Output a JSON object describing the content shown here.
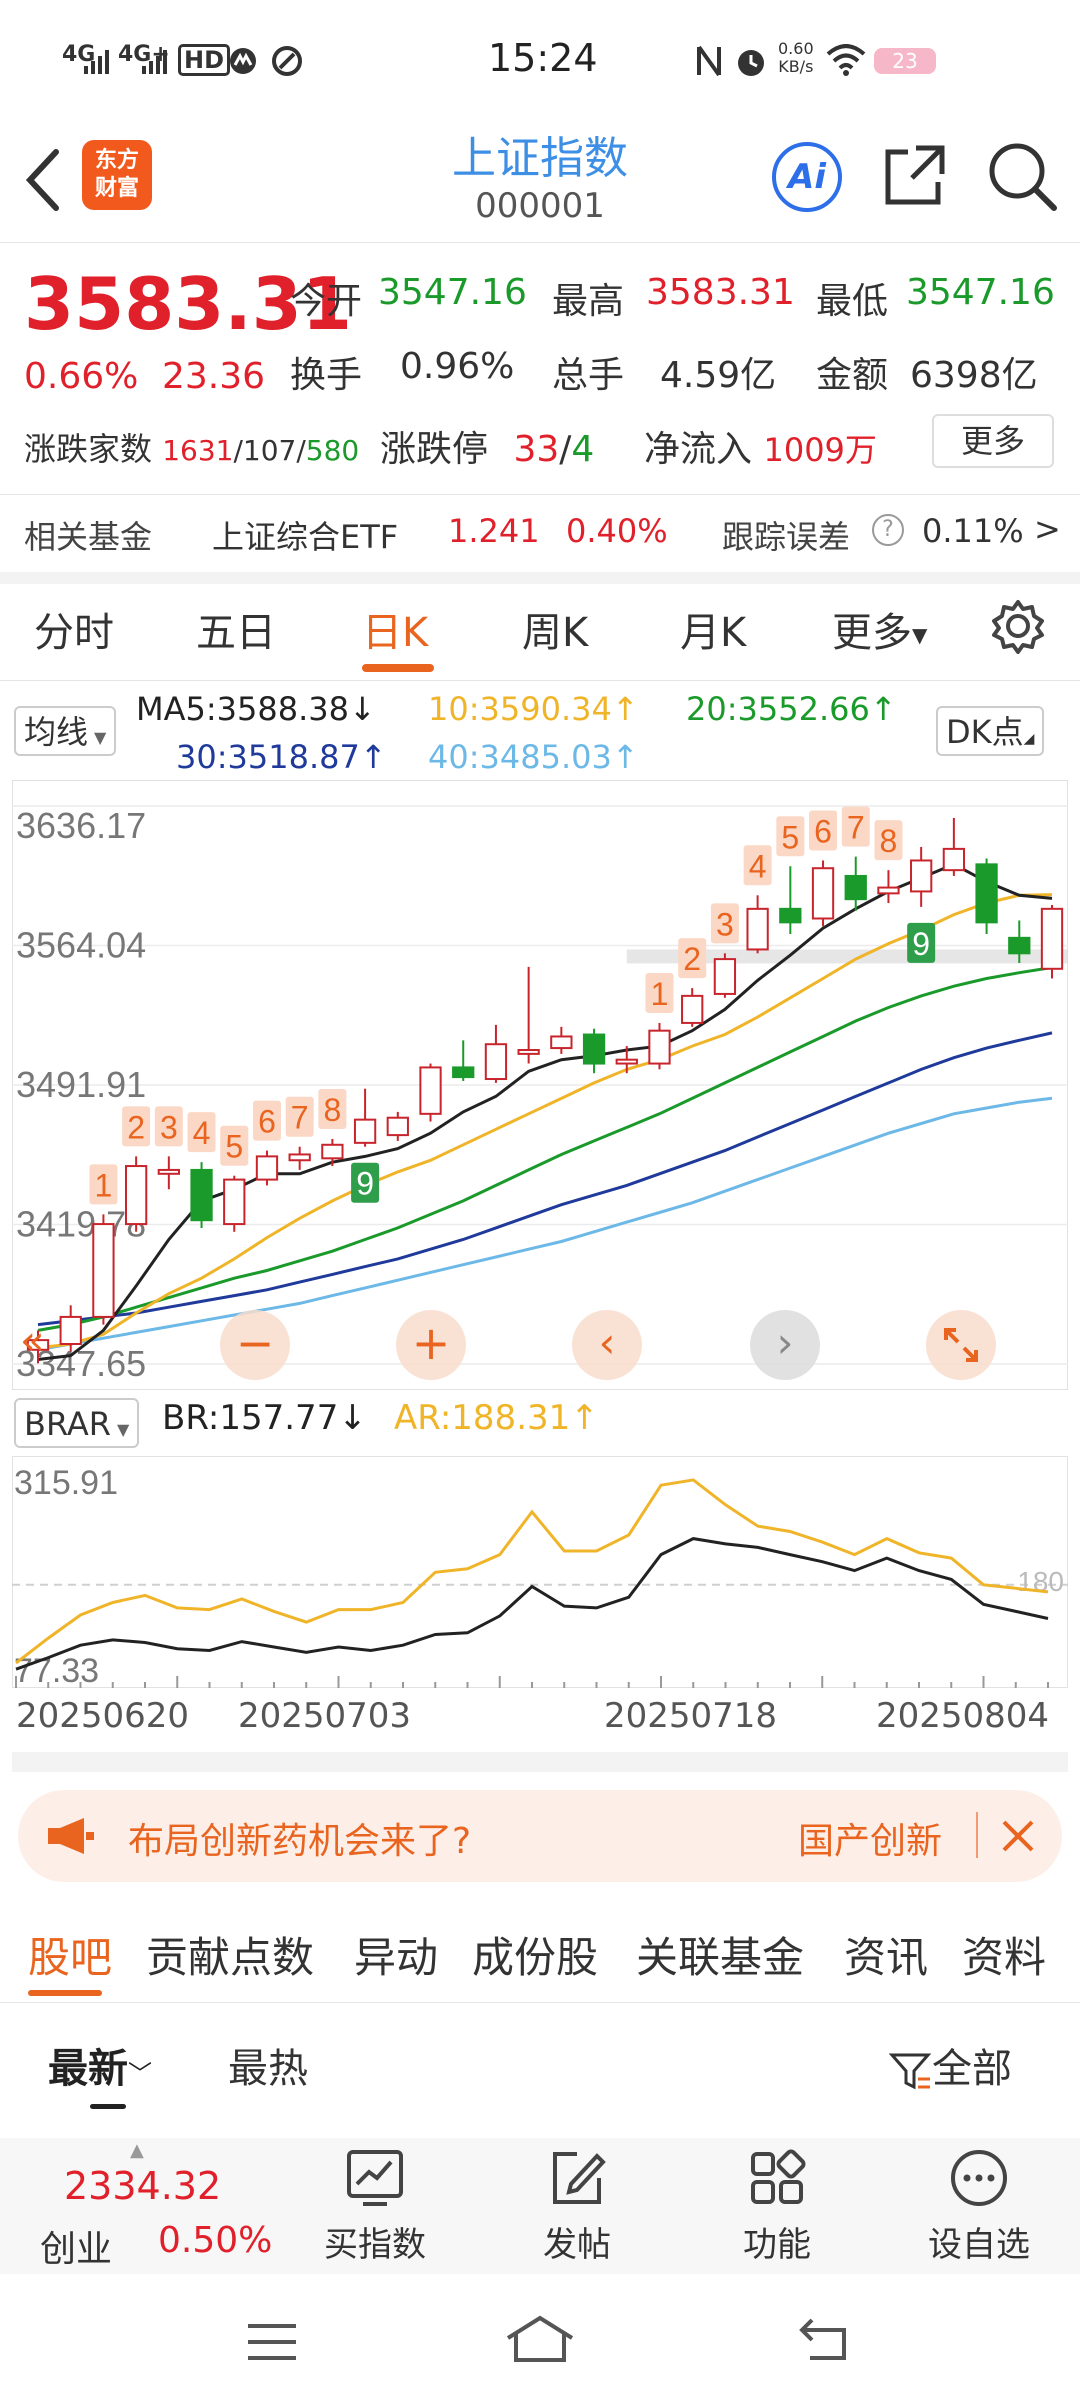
{
  "status": {
    "signal1": "4G",
    "signal2": "4G+",
    "hd": "HD",
    "time": "15:24",
    "net_speed_value": "0.60",
    "net_speed_unit": "KB/s",
    "battery": "23"
  },
  "header": {
    "logo_line1": "东方",
    "logo_line2": "财富",
    "title": "上证指数",
    "code": "000001",
    "ai_label": "Ai"
  },
  "quote": {
    "price": "3583.31",
    "change_pct": "0.66%",
    "change_amt": "23.36",
    "open_label": "今开",
    "open": "3547.16",
    "high_label": "最高",
    "high": "3583.31",
    "low_label": "最低",
    "low": "3547.16",
    "turnover_label": "换手",
    "turnover": "0.96%",
    "volume_label": "总手",
    "volume": "4.59亿",
    "amount_label": "金额",
    "amount": "6398亿",
    "updown_label": "涨跌家数",
    "up": "1631",
    "flat": "107",
    "down": "580",
    "limit_label": "涨跌停",
    "limit_up": "33",
    "limit_down": "4",
    "netflow_label": "净流入",
    "netflow": "1009万",
    "more_label": "更多"
  },
  "fund": {
    "label": "相关基金",
    "name": "上证综合ETF",
    "price": "1.241",
    "pct": "0.40%",
    "track_label": "跟踪误差",
    "track_value": "0.11%",
    "arrow": ">"
  },
  "ktabs": [
    {
      "label": "分时"
    },
    {
      "label": "五日"
    },
    {
      "label": "日K"
    },
    {
      "label": "周K"
    },
    {
      "label": "月K"
    },
    {
      "label": "更多"
    }
  ],
  "ma": {
    "selector": "均线",
    "ma5": "MA5:3588.38",
    "ma10": "10:3590.34",
    "ma20": "20:3552.66",
    "ma30": "30:3518.87",
    "ma40": "40:3485.03",
    "dk_label": "DK点",
    "color_ma5": "#222222",
    "color_ma10": "#f0b429",
    "color_ma20": "#1a9a2a",
    "color_ma30": "#1f3a9a",
    "color_ma40": "#6cb8e6"
  },
  "chart_data": {
    "type": "candlestick",
    "y_ticks": [
      "3636.17",
      "3564.04",
      "3491.91",
      "3419.78",
      "3347.65"
    ],
    "ylim": [
      3347.65,
      3636.17
    ],
    "x_labels": [
      "20250620",
      "20250703",
      "20250718",
      "20250804"
    ],
    "candles": [
      {
        "o": 3355,
        "c": 3360,
        "h": 3365,
        "l": 3348
      },
      {
        "o": 3358,
        "c": 3372,
        "h": 3378,
        "l": 3354
      },
      {
        "o": 3372,
        "c": 3420,
        "h": 3425,
        "l": 3368
      },
      {
        "o": 3420,
        "c": 3450,
        "h": 3455,
        "l": 3416
      },
      {
        "o": 3446,
        "c": 3448,
        "h": 3455,
        "l": 3438
      },
      {
        "o": 3448,
        "c": 3422,
        "h": 3452,
        "l": 3418
      },
      {
        "o": 3420,
        "c": 3443,
        "h": 3445,
        "l": 3416
      },
      {
        "o": 3443,
        "c": 3455,
        "h": 3458,
        "l": 3440
      },
      {
        "o": 3453,
        "c": 3456,
        "h": 3460,
        "l": 3448
      },
      {
        "o": 3454,
        "c": 3461,
        "h": 3464,
        "l": 3450
      },
      {
        "o": 3462,
        "c": 3474,
        "h": 3490,
        "l": 3460
      },
      {
        "o": 3466,
        "c": 3475,
        "h": 3478,
        "l": 3463
      },
      {
        "o": 3477,
        "c": 3501,
        "h": 3503,
        "l": 3473
      },
      {
        "o": 3501,
        "c": 3496,
        "h": 3515,
        "l": 3494
      },
      {
        "o": 3495,
        "c": 3513,
        "h": 3523,
        "l": 3493
      },
      {
        "o": 3508,
        "c": 3510,
        "h": 3553,
        "l": 3503
      },
      {
        "o": 3511,
        "c": 3517,
        "h": 3522,
        "l": 3508
      },
      {
        "o": 3518,
        "c": 3503,
        "h": 3521,
        "l": 3498
      },
      {
        "o": 3503,
        "c": 3505,
        "h": 3512,
        "l": 3498
      },
      {
        "o": 3503,
        "c": 3520,
        "h": 3524,
        "l": 3500
      },
      {
        "o": 3524,
        "c": 3538,
        "h": 3542,
        "l": 3522
      },
      {
        "o": 3539,
        "c": 3557,
        "h": 3560,
        "l": 3537
      },
      {
        "o": 3562,
        "c": 3583,
        "h": 3590,
        "l": 3560
      },
      {
        "o": 3583,
        "c": 3576,
        "h": 3605,
        "l": 3570
      },
      {
        "o": 3578,
        "c": 3604,
        "h": 3608,
        "l": 3574
      },
      {
        "o": 3600,
        "c": 3588,
        "h": 3610,
        "l": 3582
      },
      {
        "o": 3591,
        "c": 3594,
        "h": 3603,
        "l": 3586
      },
      {
        "o": 3592,
        "c": 3608,
        "h": 3615,
        "l": 3584
      },
      {
        "o": 3603,
        "c": 3614,
        "h": 3630,
        "l": 3600
      },
      {
        "o": 3606,
        "c": 3576,
        "h": 3609,
        "l": 3570
      },
      {
        "o": 3568,
        "c": 3560,
        "h": 3577,
        "l": 3555
      },
      {
        "o": 3552,
        "c": 3583,
        "h": 3585,
        "l": 3547
      }
    ],
    "ma5": [
      3350,
      3352,
      3365,
      3388,
      3412,
      3432,
      3438,
      3446,
      3446,
      3452,
      3455,
      3459,
      3467,
      3478,
      3486,
      3499,
      3505,
      3507,
      3510,
      3512,
      3520,
      3531,
      3546,
      3559,
      3573,
      3583,
      3592,
      3599,
      3606,
      3597,
      3590,
      3588.38
    ],
    "ma10": [
      3356,
      3358,
      3363,
      3374,
      3384,
      3392,
      3402,
      3413,
      3423,
      3432,
      3440,
      3447,
      3453,
      3461,
      3469,
      3477,
      3485,
      3493,
      3500,
      3505,
      3512,
      3518,
      3527,
      3537,
      3547,
      3557,
      3565,
      3572,
      3580,
      3586,
      3590,
      3590.34
    ],
    "ma20": [
      3365,
      3368,
      3372,
      3377,
      3382,
      3387,
      3392,
      3396,
      3401,
      3406,
      3412,
      3418,
      3425,
      3432,
      3440,
      3448,
      3456,
      3463,
      3470,
      3477,
      3485,
      3493,
      3501,
      3509,
      3517,
      3525,
      3532,
      3538,
      3543,
      3547,
      3550,
      3552.66
    ],
    "ma30": [
      3368,
      3370,
      3372,
      3374,
      3377,
      3380,
      3383,
      3386,
      3390,
      3394,
      3398,
      3402,
      3407,
      3412,
      3418,
      3424,
      3430,
      3435,
      3440,
      3446,
      3452,
      3458,
      3465,
      3472,
      3479,
      3486,
      3493,
      3500,
      3506,
      3511,
      3515,
      3518.87
    ],
    "ma40": [
      3355,
      3358,
      3361,
      3364,
      3367,
      3370,
      3373,
      3376,
      3379,
      3383,
      3387,
      3391,
      3395,
      3399,
      3403,
      3407,
      3411,
      3416,
      3421,
      3426,
      3431,
      3437,
      3443,
      3449,
      3455,
      3461,
      3467,
      3472,
      3477,
      3480,
      3483,
      3485.03
    ],
    "td_labels": [
      {
        "i": 2,
        "t": "1",
        "kind": "up"
      },
      {
        "i": 3,
        "t": "2",
        "kind": "up"
      },
      {
        "i": 4,
        "t": "3",
        "kind": "up"
      },
      {
        "i": 5,
        "t": "4",
        "kind": "up"
      },
      {
        "i": 6,
        "t": "5",
        "kind": "up"
      },
      {
        "i": 7,
        "t": "6",
        "kind": "up"
      },
      {
        "i": 8,
        "t": "7",
        "kind": "up"
      },
      {
        "i": 9,
        "t": "8",
        "kind": "up"
      },
      {
        "i": 10,
        "t": "9",
        "kind": "down"
      },
      {
        "i": 19,
        "t": "1",
        "kind": "up"
      },
      {
        "i": 20,
        "t": "2",
        "kind": "up"
      },
      {
        "i": 21,
        "t": "3",
        "kind": "up"
      },
      {
        "i": 22,
        "t": "4",
        "kind": "up"
      },
      {
        "i": 23,
        "t": "5",
        "kind": "up"
      },
      {
        "i": 24,
        "t": "6",
        "kind": "up"
      },
      {
        "i": 25,
        "t": "7",
        "kind": "up"
      },
      {
        "i": 26,
        "t": "8",
        "kind": "up"
      },
      {
        "i": 27,
        "t": "9",
        "kind": "down"
      }
    ]
  },
  "brar": {
    "selector": "BRAR",
    "br": "BR:157.77",
    "ar": "AR:188.31",
    "y_top": "315.91",
    "y_bottom": "77.33",
    "ref_label": "180",
    "ylim": [
      77.33,
      315.91
    ],
    "br_values": [
      85,
      98,
      112,
      118,
      115,
      108,
      106,
      116,
      110,
      104,
      110,
      106,
      112,
      124,
      126,
      145,
      178,
      156,
      154,
      166,
      214,
      232,
      226,
      222,
      214,
      206,
      196,
      210,
      196,
      186,
      158,
      150,
      142
    ],
    "ar_values": [
      92,
      120,
      146,
      160,
      168,
      154,
      152,
      164,
      150,
      138,
      152,
      152,
      160,
      194,
      198,
      214,
      262,
      218,
      218,
      236,
      292,
      298,
      270,
      246,
      240,
      228,
      214,
      232,
      216,
      210,
      180,
      176,
      172
    ]
  },
  "ad": {
    "text": "布局创新药机会来了?",
    "tag": "国产创新"
  },
  "btabs": [
    {
      "label": "股吧"
    },
    {
      "label": "贡献点数"
    },
    {
      "label": "异动"
    },
    {
      "label": "成份股"
    },
    {
      "label": "关联基金"
    },
    {
      "label": "资讯"
    },
    {
      "label": "资料"
    }
  ],
  "sort": {
    "latest": "最新",
    "hot": "最热",
    "filter": "全部"
  },
  "bottom": {
    "index_value": "2334.32",
    "index_name": "创业",
    "index_pct": "0.50%",
    "buy": "买指数",
    "post": "发帖",
    "func": "功能",
    "watch": "设自选"
  }
}
